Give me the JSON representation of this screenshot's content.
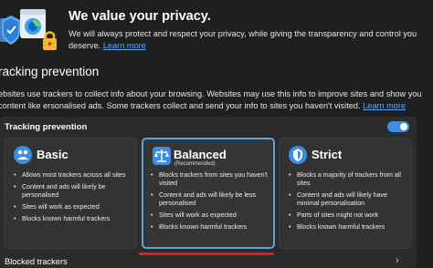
{
  "privacy": {
    "title": "We value your privacy.",
    "description": "We will always protect and respect your privacy, while giving the transparency and control you deserve.",
    "learn_more": "Learn more"
  },
  "tracking": {
    "title": "racking prevention",
    "description": "ebsites use trackers to collect info about your browsing. Websites may use this info to improve sites and show you content like ersonalised ads. Some trackers collect and send your info to sites you haven't visited.",
    "learn_more": "Learn more",
    "panel_label": "Tracking prevention",
    "toggle_on": true,
    "cards": [
      {
        "title": "Basic",
        "subtitle": "",
        "icon": "basic-level-icon",
        "items": [
          "Allows most trackers across all sites",
          "Content and ads will likely be personalised",
          "Sites will work as expected",
          "Blocks known harmful trackers"
        ]
      },
      {
        "title": "Balanced",
        "subtitle": "(Recommended)",
        "icon": "balanced-level-icon",
        "selected": true,
        "items": [
          "Blocks trackers from sites you haven't visited",
          "Content and ads will likely be less personalised",
          "Sites will work as expected",
          "Blocks known harmful trackers"
        ]
      },
      {
        "title": "Strict",
        "subtitle": "",
        "icon": "strict-level-icon",
        "items": [
          "Blocks a majority of trackers from all sites",
          "Content and ads will likely have minimal personalisation",
          "Parts of sites might not work",
          "Blocks known harmful trackers"
        ]
      }
    ],
    "blocked_trackers": "Blocked trackers"
  },
  "colors": {
    "accent": "#5ea7f0",
    "selected_border": "#57a6e0",
    "highlight": "#e01e1e",
    "toggle": "#3a8ee6"
  }
}
